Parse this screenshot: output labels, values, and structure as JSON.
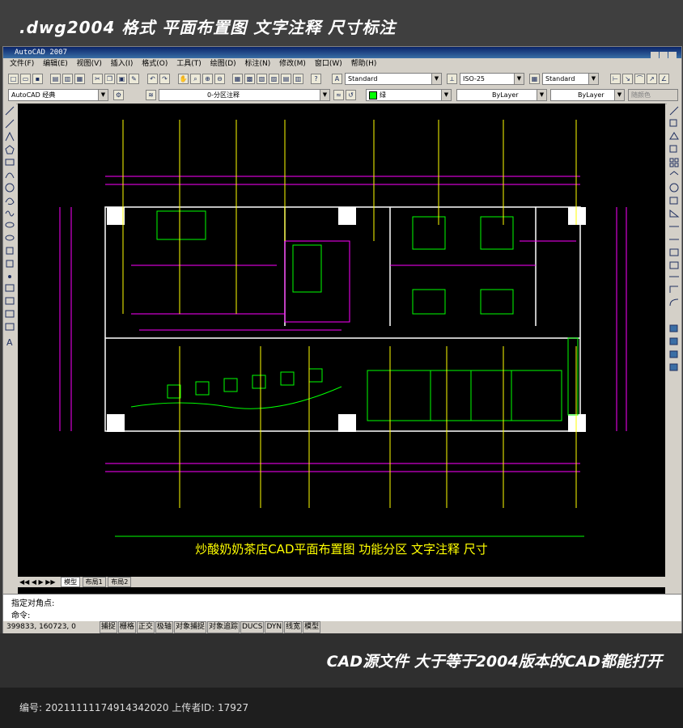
{
  "banner_top": ".dwg2004 格式   平面布置图  文字注释  尺寸标注",
  "app": {
    "title": "AutoCAD 2007",
    "menu": [
      "文件(F)",
      "编辑(E)",
      "视图(V)",
      "插入(I)",
      "格式(O)",
      "工具(T)",
      "绘图(D)",
      "标注(N)",
      "修改(M)",
      "窗口(W)",
      "帮助(H)"
    ],
    "text_style": "Standard",
    "dim_style": "ISO-25",
    "table_style": "Standard",
    "workspace": "AutoCAD 经典",
    "layer": "0-分区注释",
    "color": "绿",
    "linetype": "ByLayer",
    "lineweight": "ByLayer",
    "plotstyle": "随颜色",
    "drawing_title": "炒酸奶奶茶店CAD平面布置图   功能分区   文字注释   尺寸",
    "tabs": [
      "模型",
      "布局1",
      "布局2"
    ],
    "cmd_line1": "指定对角点:",
    "cmd_line2": "命令:",
    "coords": "399833, 160723, 0",
    "status_buttons": [
      "捕捉",
      "栅格",
      "正交",
      "极轴",
      "对象捕捉",
      "对象追踪",
      "DUCS",
      "DYN",
      "线宽",
      "模型"
    ]
  },
  "banner_bottom": "CAD源文件   大于等于2004版本的CAD都能打开",
  "footer": "编号: 20211111174914342020 上传者ID: 17927",
  "colors": {
    "canvas": "#000000",
    "wall": "#ffffff",
    "furniture": "#00ff00",
    "dimension": "#ff00ff",
    "annotation": "#ffff00",
    "title": "#ffff00"
  }
}
